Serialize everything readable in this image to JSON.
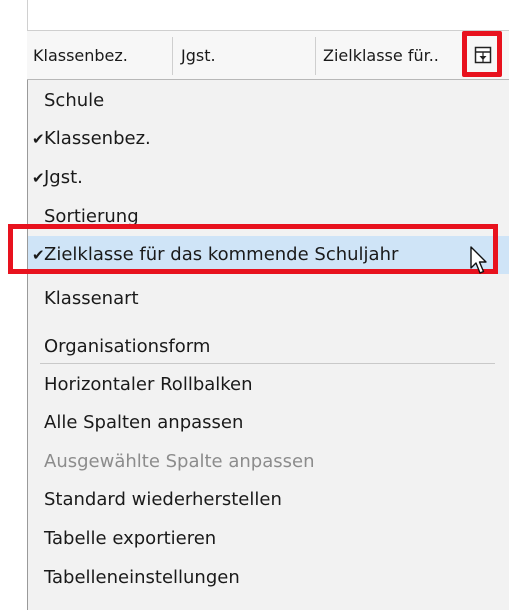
{
  "table_header": {
    "columns": [
      "Klassenbez.",
      "Jgst.",
      "Zielklasse für.."
    ],
    "column_chooser_icon": "column-chooser-icon"
  },
  "context_menu": {
    "items": [
      {
        "label": "Schule",
        "checked": false
      },
      {
        "label": "Klassenbez.",
        "checked": true
      },
      {
        "label": "Jgst.",
        "checked": true
      },
      {
        "label": "Sortierung",
        "checked": false
      },
      {
        "label": "Zielklasse für das kommende Schuljahr",
        "checked": true,
        "selected": true
      },
      {
        "label": "Klassenart",
        "checked": false
      },
      {
        "label": "Organisationsform",
        "checked": false
      }
    ],
    "actions": [
      {
        "label": "Horizontaler Rollbalken",
        "enabled": true
      },
      {
        "label": "Alle Spalten anpassen",
        "enabled": true
      },
      {
        "label": "Ausgewählte Spalte anpassen",
        "enabled": false
      },
      {
        "label": "Standard wiederherstellen",
        "enabled": true
      },
      {
        "label": "Tabelle exportieren",
        "enabled": true
      },
      {
        "label": "Tabelleneinstellungen",
        "enabled": true
      }
    ],
    "check_glyph": "✔"
  },
  "colors": {
    "highlight_border": "#e8121e",
    "selected_background": "#cfe4f7",
    "menu_background": "#f2f2f2",
    "disabled_text": "#8c8c8c"
  }
}
